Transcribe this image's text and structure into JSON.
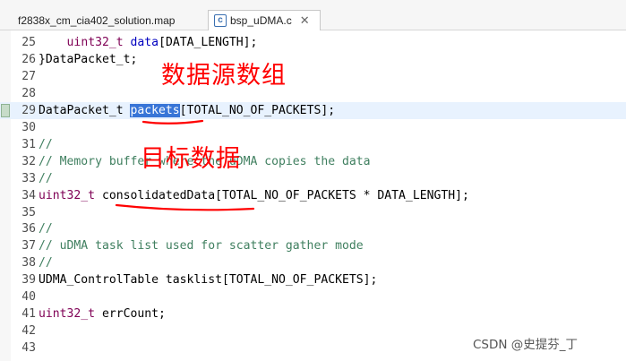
{
  "tabs": [
    {
      "label": "f2838x_cm_cia402_solution.map",
      "icon": "map-file-icon",
      "active": false
    },
    {
      "label": "bsp_uDMA.c",
      "icon": "c-source-file-icon",
      "active": true,
      "close": "✕"
    }
  ],
  "editor": {
    "lines": [
      {
        "num": "25",
        "segments": [
          {
            "t": "    "
          },
          {
            "t": "uint32_t",
            "c": "kw"
          },
          {
            "t": " "
          },
          {
            "t": "data",
            "c": "var"
          },
          {
            "t": "[DATA_LENGTH];"
          }
        ]
      },
      {
        "num": "26",
        "segments": [
          {
            "t": "}DataPacket_t;"
          }
        ]
      },
      {
        "num": "27",
        "segments": []
      },
      {
        "num": "28",
        "segments": []
      },
      {
        "num": "29",
        "current": true,
        "marker": true,
        "segments": [
          {
            "t": "DataPacket_t "
          },
          {
            "t": "packets",
            "c": "sel"
          },
          {
            "t": "[TOTAL_NO_OF_PACKETS];"
          }
        ]
      },
      {
        "num": "30",
        "segments": []
      },
      {
        "num": "31",
        "segments": [
          {
            "t": "//",
            "c": "cmt"
          }
        ]
      },
      {
        "num": "32",
        "segments": [
          {
            "t": "// Memory buffer where the uDMA copies the data",
            "c": "cmt"
          }
        ]
      },
      {
        "num": "33",
        "segments": [
          {
            "t": "//",
            "c": "cmt"
          }
        ]
      },
      {
        "num": "34",
        "segments": [
          {
            "t": "uint32_t",
            "c": "kw"
          },
          {
            "t": " consolidatedData[TOTAL_NO_OF_PACKETS * DATA_LENGTH];"
          }
        ]
      },
      {
        "num": "35",
        "segments": []
      },
      {
        "num": "36",
        "segments": [
          {
            "t": "//",
            "c": "cmt"
          }
        ]
      },
      {
        "num": "37",
        "segments": [
          {
            "t": "// uDMA task list used for scatter gather mode",
            "c": "cmt"
          }
        ]
      },
      {
        "num": "38",
        "segments": [
          {
            "t": "//",
            "c": "cmt"
          }
        ]
      },
      {
        "num": "39",
        "segments": [
          {
            "t": "UDMA_ControlTable tasklist[TOTAL_NO_OF_PACKETS];"
          }
        ]
      },
      {
        "num": "40",
        "segments": []
      },
      {
        "num": "41",
        "segments": [
          {
            "t": "uint32_t",
            "c": "kw"
          },
          {
            "t": " errCount;"
          }
        ]
      },
      {
        "num": "42",
        "segments": []
      },
      {
        "num": "43",
        "segments": []
      }
    ]
  },
  "annotations": {
    "source_array": "数据源数组",
    "target_data": "目标数据"
  },
  "watermark": "CSDN @史提芬_丁"
}
